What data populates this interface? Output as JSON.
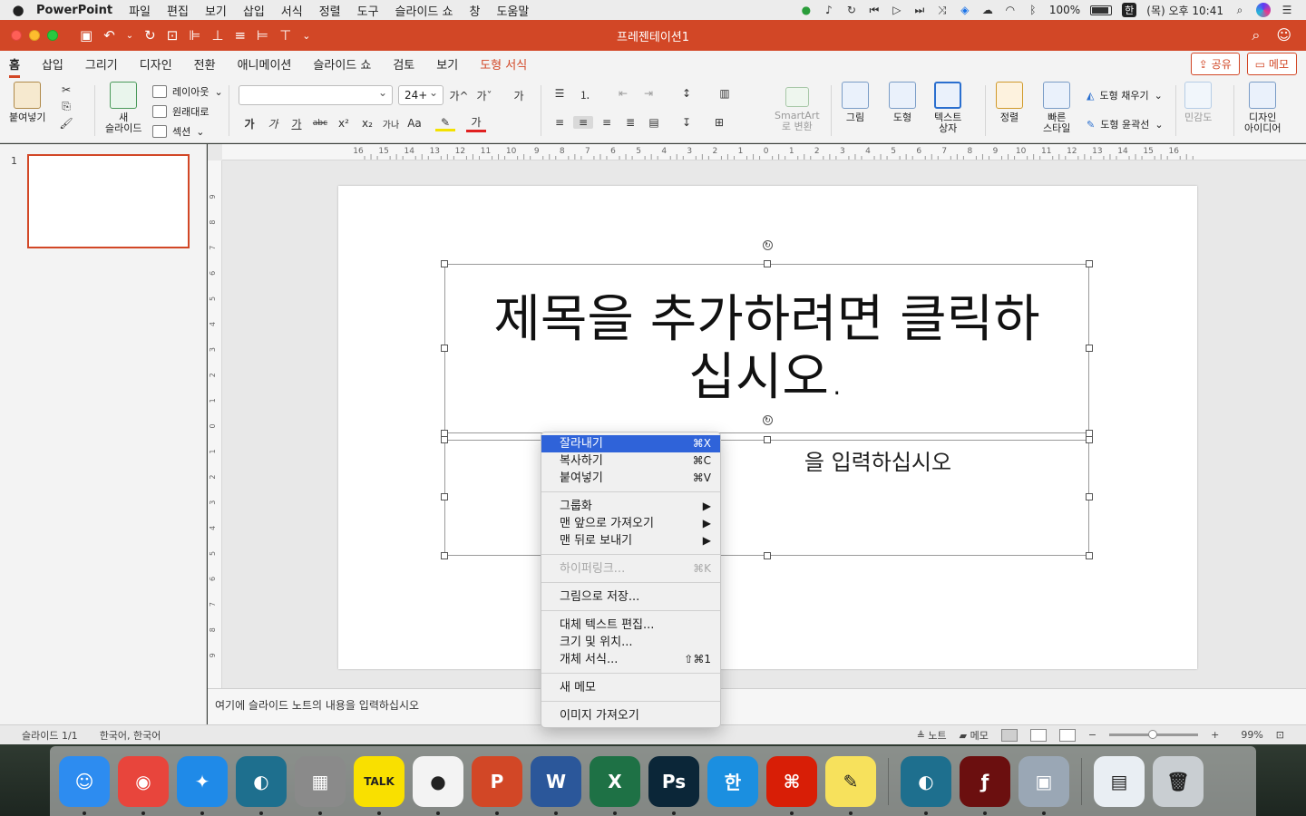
{
  "menubar": {
    "app_name": "PowerPoint",
    "items": [
      "파일",
      "편집",
      "보기",
      "삽입",
      "서식",
      "정렬",
      "도구",
      "슬라이드 쇼",
      "창",
      "도움말"
    ],
    "battery": "100%",
    "input_method": "한",
    "clock": "(목) 오후 10:41"
  },
  "window": {
    "title": "프레젠테이션1"
  },
  "ribbon": {
    "tabs": [
      "홈",
      "삽입",
      "그리기",
      "디자인",
      "전환",
      "애니메이션",
      "슬라이드 쇼",
      "검토",
      "보기",
      "도형 서식"
    ],
    "share_label": "공유",
    "comment_label": "메모",
    "paste_label": "붙여넣기",
    "new_slide_label_1": "새",
    "new_slide_label_2": "슬라이드",
    "layout_label": "레이아웃",
    "reset_label": "원래대로",
    "section_label": "섹션",
    "font_name": "",
    "font_size": "24+",
    "font_grow": "가^",
    "font_shrink": "가ˇ",
    "clear_format": "가",
    "bold": "가",
    "italic": "가",
    "underline": "가",
    "strike": "abc",
    "superscript": "x²",
    "subscript": "x₂",
    "spacing": "가나",
    "change_case": "Aa",
    "highlight": "✎",
    "font_color": "가",
    "smartart_label_1": "SmartArt",
    "smartart_label_2": "로 변환",
    "picture_label": "그림",
    "shape_label": "도형",
    "textbox_label_1": "텍스트",
    "textbox_label_2": "상자",
    "arrange_label": "정렬",
    "quickstyle_label_1": "빠른",
    "quickstyle_label_2": "스타일",
    "shape_fill_label": "도형 채우기",
    "shape_outline_label": "도형 윤곽선",
    "sensitivity_label": "민감도",
    "designer_label_1": "디자인",
    "designer_label_2": "아이디어"
  },
  "thumbnails": {
    "slide_number": "1"
  },
  "ruler": {
    "h_marks": [
      "16",
      "15",
      "14",
      "13",
      "12",
      "11",
      "10",
      "9",
      "8",
      "7",
      "6",
      "5",
      "4",
      "3",
      "2",
      "1",
      "0",
      "1",
      "2",
      "3",
      "4",
      "5",
      "6",
      "7",
      "8",
      "9",
      "10",
      "11",
      "12",
      "13",
      "14",
      "15",
      "16"
    ],
    "v_marks": [
      "9",
      "8",
      "7",
      "6",
      "5",
      "4",
      "3",
      "2",
      "1",
      "0",
      "1",
      "2",
      "3",
      "4",
      "5",
      "6",
      "7",
      "8",
      "9"
    ]
  },
  "slide": {
    "title_placeholder_line1": "제목을 추가하려면 클릭하",
    "title_placeholder_line2": "십시오.",
    "subtitle_placeholder_visible": "을 입력하십시오"
  },
  "notes": {
    "placeholder": "여기에 슬라이드 노트의 내용을 입력하십시오"
  },
  "status": {
    "slide_info": "슬라이드 1/1",
    "language": "한국어, 한국어",
    "notes_label": "노트",
    "comments_label": "메모",
    "zoom_percent": "99%",
    "zoom_level": 0.49
  },
  "context_menu": {
    "items": [
      {
        "label": "잘라내기",
        "shortcut": "⌘X"
      },
      {
        "label": "복사하기",
        "shortcut": "⌘C"
      },
      {
        "label": "붙여넣기",
        "shortcut": "⌘V"
      },
      {
        "label": "그룹화",
        "shortcut": "▶"
      },
      {
        "label": "맨 앞으로 가져오기",
        "shortcut": "▶"
      },
      {
        "label": "맨 뒤로 보내기",
        "shortcut": "▶"
      },
      {
        "label": "하이퍼링크...",
        "shortcut": "⌘K"
      },
      {
        "label": "그림으로 저장...",
        "shortcut": ""
      },
      {
        "label": "대체 텍스트 편집...",
        "shortcut": ""
      },
      {
        "label": "크기 및 위치...",
        "shortcut": ""
      },
      {
        "label": "개체 서식...",
        "shortcut": "⇧⌘1"
      },
      {
        "label": "새 메모",
        "shortcut": ""
      },
      {
        "label": "이미지 가져오기",
        "shortcut": ""
      }
    ]
  },
  "dock": {
    "apps": [
      {
        "name": "Finder",
        "icon": "finder-icon",
        "glyph": "☺",
        "color": "#2d8cf0"
      },
      {
        "name": "Chrome",
        "icon": "chrome-icon",
        "glyph": "◉",
        "color": "#e8453c"
      },
      {
        "name": "Safari",
        "icon": "safari-icon",
        "glyph": "✦",
        "color": "#1f8ae8"
      },
      {
        "name": "Whale",
        "icon": "whale-icon",
        "glyph": "◐",
        "color": "#1e6f8e"
      },
      {
        "name": "Calculator",
        "icon": "calculator-icon",
        "glyph": "▦",
        "color": "#8a8a8a"
      },
      {
        "name": "KakaoTalk",
        "icon": "kakaotalk-icon",
        "glyph": "TALK",
        "color": "#f9e000"
      },
      {
        "name": "Line",
        "icon": "line-icon",
        "glyph": "●",
        "color": "#f3f3f3"
      },
      {
        "name": "PowerPoint",
        "icon": "powerpoint-icon",
        "glyph": "P",
        "color": "#d24726"
      },
      {
        "name": "Word",
        "icon": "word-icon",
        "glyph": "W",
        "color": "#2b579a"
      },
      {
        "name": "Excel",
        "icon": "excel-icon",
        "glyph": "X",
        "color": "#1e7145"
      },
      {
        "name": "Photoshop",
        "icon": "photoshop-icon",
        "glyph": "Ps",
        "color": "#0b2638"
      },
      {
        "name": "HWP Viewer",
        "icon": "hwp-viewer-icon",
        "glyph": "한",
        "color": "#1b8fe0"
      },
      {
        "name": "Acrobat",
        "icon": "acrobat-icon",
        "glyph": "⌘",
        "color": "#d81e06"
      },
      {
        "name": "Stickies",
        "icon": "stickies-icon",
        "glyph": "✎",
        "color": "#f7e15c"
      },
      {
        "name": "Whale 2",
        "icon": "whale-icon-2",
        "glyph": "◐",
        "color": "#1e6f8e"
      },
      {
        "name": "Flash",
        "icon": "flash-icon",
        "glyph": "ƒ",
        "color": "#6b0f0f"
      },
      {
        "name": "Preview",
        "icon": "preview-icon",
        "glyph": "▣",
        "color": "#9aa7b5"
      },
      {
        "name": "Recent",
        "icon": "recent-docs-icon",
        "glyph": "▤",
        "color": "#e9eef3"
      },
      {
        "name": "Trash",
        "icon": "trash-icon",
        "glyph": "🗑",
        "color": "#c9ced2"
      }
    ]
  }
}
